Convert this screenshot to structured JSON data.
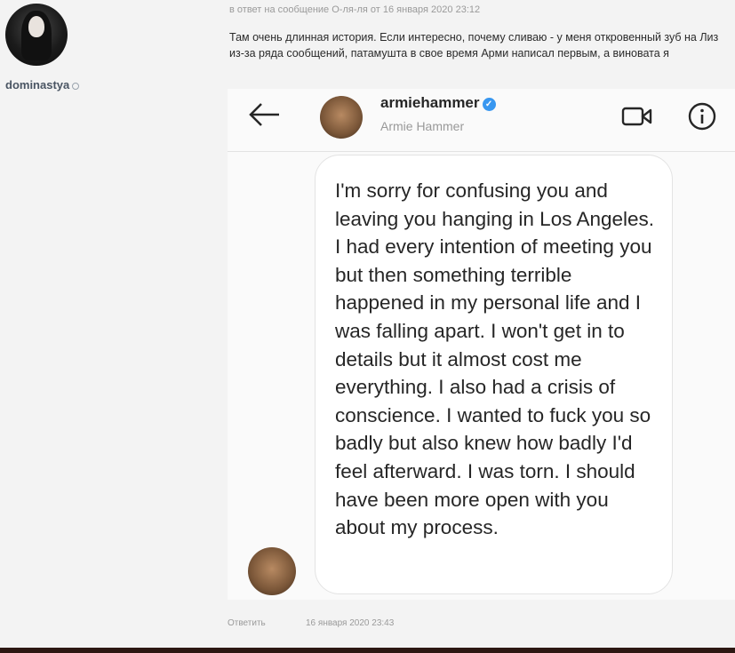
{
  "comment": {
    "author": "dominastya",
    "reply_meta": "в ответ на сообщение О-ля-ля от 16 января 2020 23:12",
    "text": "Там очень длинная история. Если интересно, почему сливаю - у меня откровенный зуб на Лиз из-за ряда сообщений, патамушта в свое время Арми написал первым, а виновата я",
    "reply_label": "Ответить",
    "date": "16 января 2020 23:43"
  },
  "dm": {
    "username": "armiehammer",
    "verified": "✓",
    "full_name": "Armie Hammer",
    "message": "I'm sorry for confusing you and leaving you hanging in Los Angeles. I had every intention of meeting you but then something terrible happened in my personal life and I was falling apart. I won't get in to details but it almost cost me everything. I also had a crisis of conscience. I wanted to fuck you so badly but also knew how badly I'd feel afterward. I was torn. I should have been more open with you about my process.",
    "icons": {
      "back": "back-arrow-icon",
      "video": "video-camera-icon",
      "info": "info-icon"
    }
  },
  "colors": {
    "verified_blue": "#3897f0",
    "bottom_bar": "#2c1712"
  }
}
